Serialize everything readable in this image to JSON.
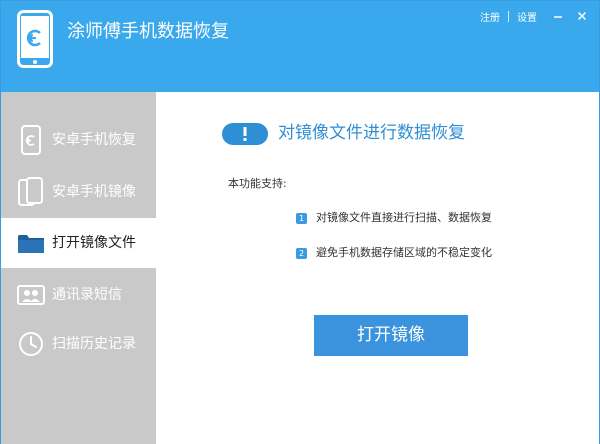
{
  "app": {
    "title": "涂师傅手机数据恢复",
    "top_links": {
      "register": "注册",
      "settings": "设置"
    },
    "window_controls": {
      "minimize_icon": "minimize-icon",
      "close_icon": "close-icon"
    }
  },
  "sidebar": {
    "items": [
      {
        "label": "安卓手机恢复",
        "icon": "phone-restore-icon",
        "active": false
      },
      {
        "label": "安卓手机镜像",
        "icon": "phone-mirror-icon",
        "active": false
      },
      {
        "label": "打开镜像文件",
        "icon": "folder-icon",
        "active": true
      },
      {
        "label": "通讯录短信",
        "icon": "contacts-icon",
        "active": false
      },
      {
        "label": "扫描历史记录",
        "icon": "clock-icon",
        "active": false
      }
    ]
  },
  "main": {
    "heading": "对镜像文件进行数据恢复",
    "support_label": "本功能支持:",
    "features": [
      {
        "num": "1",
        "text": "对镜像文件直接进行扫描、数据恢复"
      },
      {
        "num": "2",
        "text": "避免手机数据存储区域的不稳定变化"
      }
    ],
    "button_label": "打开镜像"
  },
  "colors": {
    "titlebar": "#3aa8ec",
    "sidebar": "#c9c9c9",
    "accent": "#2f8fd4",
    "button": "#3a93dc"
  }
}
